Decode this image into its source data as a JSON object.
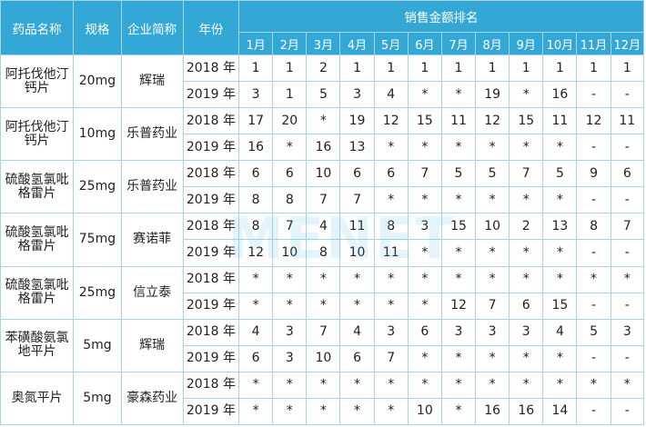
{
  "headers": {
    "drug": "药品名称",
    "spec": "规格",
    "company": "企业简称",
    "year": "年份",
    "sales_rank": "销售金额排名",
    "months": [
      "1月",
      "2月",
      "3月",
      "4月",
      "5月",
      "6月",
      "7月",
      "8月",
      "9月",
      "10月",
      "11月",
      "12月"
    ]
  },
  "groups": [
    {
      "drug": "阿托伐他汀钙片",
      "spec": "20mg",
      "company": "辉瑞",
      "rows": [
        {
          "year": "2018 年",
          "ranks": [
            "1",
            "1",
            "2",
            "1",
            "1",
            "1",
            "1",
            "1",
            "1",
            "1",
            "1",
            "1"
          ]
        },
        {
          "year": "2019 年",
          "ranks": [
            "3",
            "1",
            "5",
            "3",
            "4",
            "*",
            "*",
            "19",
            "*",
            "16",
            "-",
            "-"
          ]
        }
      ]
    },
    {
      "drug": "阿托伐他汀钙片",
      "spec": "10mg",
      "company": "乐普药业",
      "rows": [
        {
          "year": "2018 年",
          "ranks": [
            "17",
            "20",
            "*",
            "19",
            "12",
            "15",
            "11",
            "12",
            "15",
            "11",
            "12",
            "11"
          ]
        },
        {
          "year": "2019 年",
          "ranks": [
            "16",
            "*",
            "16",
            "13",
            "*",
            "*",
            "*",
            "*",
            "*",
            "*",
            "-",
            "-"
          ]
        }
      ]
    },
    {
      "drug": "硫酸氢氯吡格雷片",
      "spec": "25mg",
      "company": "乐普药业",
      "rows": [
        {
          "year": "2018 年",
          "ranks": [
            "6",
            "6",
            "10",
            "6",
            "6",
            "7",
            "5",
            "5",
            "7",
            "5",
            "9",
            "6"
          ]
        },
        {
          "year": "2019 年",
          "ranks": [
            "8",
            "8",
            "7",
            "7",
            "*",
            "*",
            "*",
            "*",
            "*",
            "*",
            "-",
            "-"
          ]
        }
      ]
    },
    {
      "drug": "硫酸氢氯吡格雷片",
      "spec": "75mg",
      "company": "赛诺菲",
      "rows": [
        {
          "year": "2018 年",
          "ranks": [
            "8",
            "7",
            "4",
            "11",
            "8",
            "3",
            "15",
            "10",
            "2",
            "13",
            "8",
            "7"
          ]
        },
        {
          "year": "2019 年",
          "ranks": [
            "12",
            "10",
            "8",
            "10",
            "11",
            "*",
            "*",
            "*",
            "*",
            "*",
            "-",
            "-"
          ]
        }
      ]
    },
    {
      "drug": "硫酸氢氯吡格雷片",
      "spec": "25mg",
      "company": "信立泰",
      "rows": [
        {
          "year": "2018 年",
          "ranks": [
            "*",
            "*",
            "*",
            "*",
            "*",
            "*",
            "*",
            "*",
            "*",
            "*",
            "*",
            "*"
          ]
        },
        {
          "year": "2019 年",
          "ranks": [
            "*",
            "*",
            "*",
            "*",
            "*",
            "*",
            "12",
            "7",
            "6",
            "15",
            "-",
            "-"
          ]
        }
      ]
    },
    {
      "drug": "苯磺酸氨氯地平片",
      "spec": "5mg",
      "company": "辉瑞",
      "rows": [
        {
          "year": "2018 年",
          "ranks": [
            "4",
            "3",
            "7",
            "4",
            "3",
            "6",
            "3",
            "3",
            "3",
            "4",
            "5",
            "3"
          ]
        },
        {
          "year": "2019 年",
          "ranks": [
            "6",
            "3",
            "10",
            "6",
            "7",
            "*",
            "*",
            "*",
            "*",
            "*",
            "-",
            "-"
          ]
        }
      ]
    },
    {
      "drug": "奥氮平片",
      "spec": "5mg",
      "company": "豪森药业",
      "rows": [
        {
          "year": "2018 年",
          "ranks": [
            "*",
            "*",
            "*",
            "*",
            "*",
            "*",
            "*",
            "*",
            "*",
            "*",
            "*",
            "*"
          ]
        },
        {
          "year": "2019 年",
          "ranks": [
            "*",
            "*",
            "*",
            "*",
            "*",
            "10",
            "*",
            "16",
            "16",
            "14",
            "-",
            "-"
          ]
        }
      ]
    }
  ],
  "watermark": "MENET"
}
